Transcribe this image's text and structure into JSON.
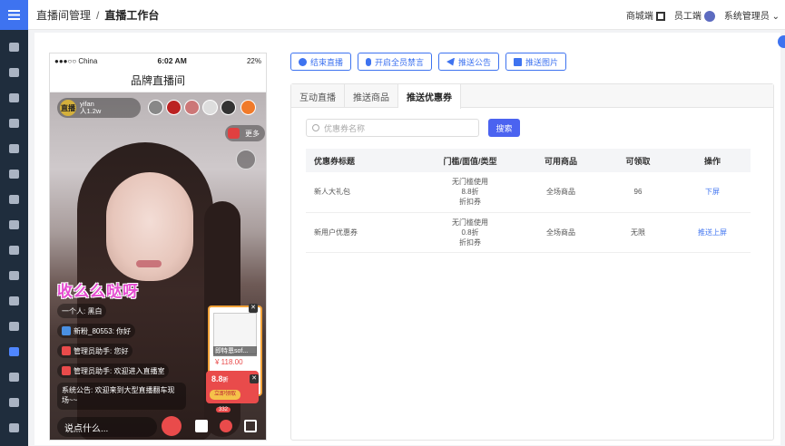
{
  "header": {
    "breadcrumb_1": "直播间管理",
    "breadcrumb_sep": "/",
    "breadcrumb_2": "直播工作台",
    "mall_label": "商城端",
    "staff_label": "员工端",
    "admin_label": "系统管理员",
    "admin_chevron": "⌄"
  },
  "phone": {
    "carrier": "●●●○○ China",
    "time": "6:02 AM",
    "battery": "22%",
    "title": "品牌直播间",
    "host_badge": "直播",
    "host_name": "yifan",
    "host_viewers": "人1.2w",
    "more_label": "更多",
    "overlay_text": "收么么哒呀",
    "chat": [
      {
        "text": "一个人: 黑白"
      },
      {
        "text": "新粉_80553: 你好"
      },
      {
        "text": "管理员助手: 您好"
      },
      {
        "text": "管理员助手: 欢迎进入直播室"
      }
    ],
    "notice": "系统公告: 欢迎来到大型直播翻车现场~~",
    "input_placeholder": "说点什么...",
    "heart_count": "332",
    "product": {
      "name": "即特恩sof...",
      "price": "¥ 118.00"
    },
    "coupon": {
      "value": "8.8",
      "unit": "折",
      "button": "立即领取"
    }
  },
  "actions": {
    "end_live": "结束直播",
    "mute_all": "开启全员禁言",
    "push_notice": "推送公告",
    "push_image": "推送图片"
  },
  "tabs": [
    "互动直播",
    "推送商品",
    "推送优惠券"
  ],
  "search": {
    "placeholder": "优惠券名称",
    "button": "搜索"
  },
  "table": {
    "headers": [
      "优惠券标题",
      "门槛/面值/类型",
      "可用商品",
      "可领取",
      "操作"
    ],
    "rows": [
      {
        "title": "新人大礼包",
        "threshold": "无门槛使用",
        "value": "8.8折",
        "type": "折扣券",
        "goods": "全场商品",
        "available": "96",
        "action": "下屏"
      },
      {
        "title": "新用户优惠券",
        "threshold": "无门槛使用",
        "value": "0.8折",
        "type": "折扣券",
        "goods": "全场商品",
        "available": "无限",
        "action": "推送上屏"
      }
    ]
  }
}
